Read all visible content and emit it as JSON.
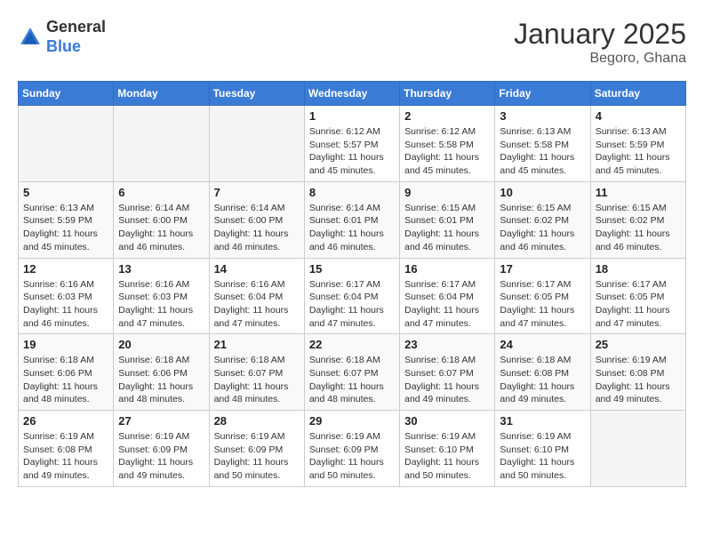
{
  "header": {
    "logo_general": "General",
    "logo_blue": "Blue",
    "title": "January 2025",
    "subtitle": "Begoro, Ghana"
  },
  "weekdays": [
    "Sunday",
    "Monday",
    "Tuesday",
    "Wednesday",
    "Thursday",
    "Friday",
    "Saturday"
  ],
  "weeks": [
    [
      {
        "day": "",
        "info": ""
      },
      {
        "day": "",
        "info": ""
      },
      {
        "day": "",
        "info": ""
      },
      {
        "day": "1",
        "info": "Sunrise: 6:12 AM\nSunset: 5:57 PM\nDaylight: 11 hours and 45 minutes."
      },
      {
        "day": "2",
        "info": "Sunrise: 6:12 AM\nSunset: 5:58 PM\nDaylight: 11 hours and 45 minutes."
      },
      {
        "day": "3",
        "info": "Sunrise: 6:13 AM\nSunset: 5:58 PM\nDaylight: 11 hours and 45 minutes."
      },
      {
        "day": "4",
        "info": "Sunrise: 6:13 AM\nSunset: 5:59 PM\nDaylight: 11 hours and 45 minutes."
      }
    ],
    [
      {
        "day": "5",
        "info": "Sunrise: 6:13 AM\nSunset: 5:59 PM\nDaylight: 11 hours and 45 minutes."
      },
      {
        "day": "6",
        "info": "Sunrise: 6:14 AM\nSunset: 6:00 PM\nDaylight: 11 hours and 46 minutes."
      },
      {
        "day": "7",
        "info": "Sunrise: 6:14 AM\nSunset: 6:00 PM\nDaylight: 11 hours and 46 minutes."
      },
      {
        "day": "8",
        "info": "Sunrise: 6:14 AM\nSunset: 6:01 PM\nDaylight: 11 hours and 46 minutes."
      },
      {
        "day": "9",
        "info": "Sunrise: 6:15 AM\nSunset: 6:01 PM\nDaylight: 11 hours and 46 minutes."
      },
      {
        "day": "10",
        "info": "Sunrise: 6:15 AM\nSunset: 6:02 PM\nDaylight: 11 hours and 46 minutes."
      },
      {
        "day": "11",
        "info": "Sunrise: 6:15 AM\nSunset: 6:02 PM\nDaylight: 11 hours and 46 minutes."
      }
    ],
    [
      {
        "day": "12",
        "info": "Sunrise: 6:16 AM\nSunset: 6:03 PM\nDaylight: 11 hours and 46 minutes."
      },
      {
        "day": "13",
        "info": "Sunrise: 6:16 AM\nSunset: 6:03 PM\nDaylight: 11 hours and 47 minutes."
      },
      {
        "day": "14",
        "info": "Sunrise: 6:16 AM\nSunset: 6:04 PM\nDaylight: 11 hours and 47 minutes."
      },
      {
        "day": "15",
        "info": "Sunrise: 6:17 AM\nSunset: 6:04 PM\nDaylight: 11 hours and 47 minutes."
      },
      {
        "day": "16",
        "info": "Sunrise: 6:17 AM\nSunset: 6:04 PM\nDaylight: 11 hours and 47 minutes."
      },
      {
        "day": "17",
        "info": "Sunrise: 6:17 AM\nSunset: 6:05 PM\nDaylight: 11 hours and 47 minutes."
      },
      {
        "day": "18",
        "info": "Sunrise: 6:17 AM\nSunset: 6:05 PM\nDaylight: 11 hours and 47 minutes."
      }
    ],
    [
      {
        "day": "19",
        "info": "Sunrise: 6:18 AM\nSunset: 6:06 PM\nDaylight: 11 hours and 48 minutes."
      },
      {
        "day": "20",
        "info": "Sunrise: 6:18 AM\nSunset: 6:06 PM\nDaylight: 11 hours and 48 minutes."
      },
      {
        "day": "21",
        "info": "Sunrise: 6:18 AM\nSunset: 6:07 PM\nDaylight: 11 hours and 48 minutes."
      },
      {
        "day": "22",
        "info": "Sunrise: 6:18 AM\nSunset: 6:07 PM\nDaylight: 11 hours and 48 minutes."
      },
      {
        "day": "23",
        "info": "Sunrise: 6:18 AM\nSunset: 6:07 PM\nDaylight: 11 hours and 49 minutes."
      },
      {
        "day": "24",
        "info": "Sunrise: 6:18 AM\nSunset: 6:08 PM\nDaylight: 11 hours and 49 minutes."
      },
      {
        "day": "25",
        "info": "Sunrise: 6:19 AM\nSunset: 6:08 PM\nDaylight: 11 hours and 49 minutes."
      }
    ],
    [
      {
        "day": "26",
        "info": "Sunrise: 6:19 AM\nSunset: 6:08 PM\nDaylight: 11 hours and 49 minutes."
      },
      {
        "day": "27",
        "info": "Sunrise: 6:19 AM\nSunset: 6:09 PM\nDaylight: 11 hours and 49 minutes."
      },
      {
        "day": "28",
        "info": "Sunrise: 6:19 AM\nSunset: 6:09 PM\nDaylight: 11 hours and 50 minutes."
      },
      {
        "day": "29",
        "info": "Sunrise: 6:19 AM\nSunset: 6:09 PM\nDaylight: 11 hours and 50 minutes."
      },
      {
        "day": "30",
        "info": "Sunrise: 6:19 AM\nSunset: 6:10 PM\nDaylight: 11 hours and 50 minutes."
      },
      {
        "day": "31",
        "info": "Sunrise: 6:19 AM\nSunset: 6:10 PM\nDaylight: 11 hours and 50 minutes."
      },
      {
        "day": "",
        "info": ""
      }
    ]
  ]
}
